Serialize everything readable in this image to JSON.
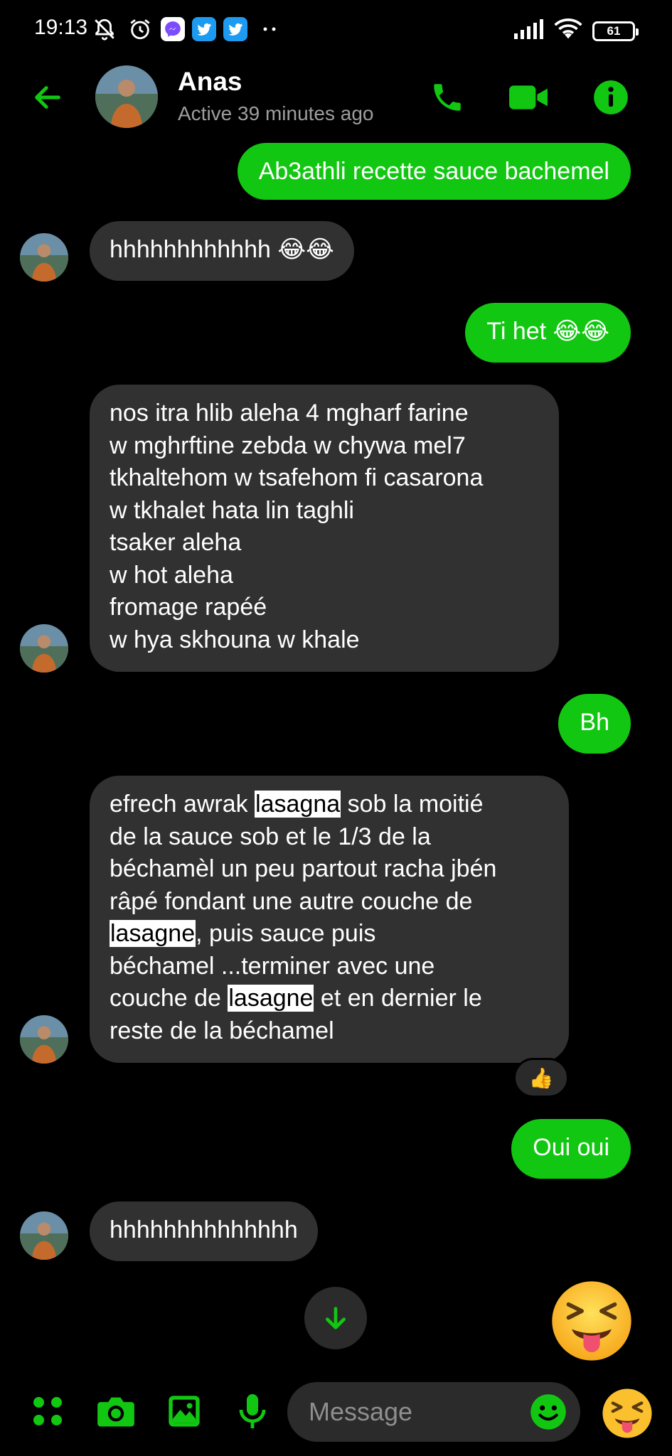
{
  "status_bar": {
    "time": "19:13",
    "battery": "61",
    "icons": [
      "dnd-off-icon",
      "alarm-icon",
      "messenger-icon",
      "twitter-icon",
      "twitter-icon",
      "more-dots-icon",
      "signal-icon",
      "wifi-icon",
      "battery-icon"
    ]
  },
  "header": {
    "name": "Anas",
    "status": "Active 39 minutes ago",
    "accent": "#12c712"
  },
  "messages": [
    {
      "dir": "out",
      "text": "Ab3athli recette sauce bachemel"
    },
    {
      "dir": "in",
      "text": "hhhhhhhhhhhh 😂😂"
    },
    {
      "dir": "out",
      "text": "Ti het 😂😂"
    },
    {
      "dir": "in",
      "text": "nos itra hlib aleha 4 mgharf farine\nw mghrftine zebda w chywa mel7\ntkhaltehom w tsafehom fi casarona\nw tkhalet hata lin taghli\ntsaker aleha\nw hot aleha\nfromage rapéé\nw hya skhouna w khale"
    },
    {
      "dir": "out",
      "text": "Bh"
    },
    {
      "dir": "in",
      "parts": {
        "p1": "efrech awrak ",
        "h1": "lasagna",
        "p2": " sob la moitié\nde la sauce sob et le 1/3 de la\nbéchamèl un peu partout racha jbén\nrâpé fondant une autre couche de\n",
        "h2": "lasagne",
        "p3": ", puis sauce puis\nbéchamel ...terminer avec une\ncouche de ",
        "h3": "lasagne",
        "p4": " et en dernier le\nreste de la béchamel"
      },
      "reaction": "👍"
    },
    {
      "dir": "out",
      "text": "Oui oui"
    },
    {
      "dir": "in",
      "text": "hhhhhhhhhhhhhh"
    }
  ],
  "composer": {
    "placeholder": "Message"
  }
}
